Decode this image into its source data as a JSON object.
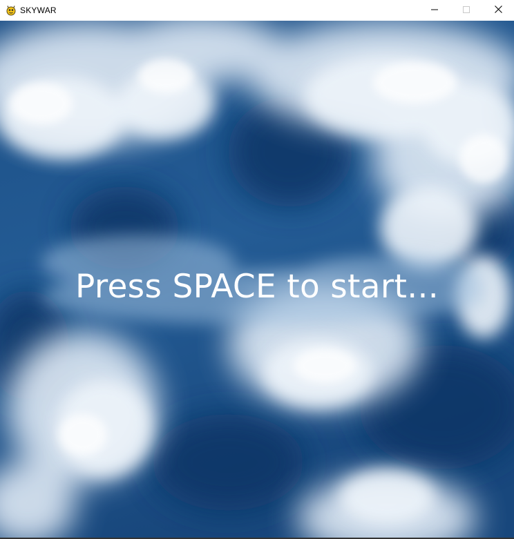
{
  "window": {
    "title": "SKYWAR",
    "app_icon": "pygame-snake-icon",
    "controls": {
      "minimize_icon": "minimize-icon",
      "maximize_icon": "maximize-icon",
      "close_icon": "close-icon"
    }
  },
  "game": {
    "prompt": "Press SPACE to start...",
    "background": "sky-clouds",
    "colors": {
      "sky_deep": "#0f3a6e",
      "sky_mid": "#2a6aa6",
      "cloud": "#e8f0f8",
      "prompt_text": "#ffffff"
    }
  }
}
